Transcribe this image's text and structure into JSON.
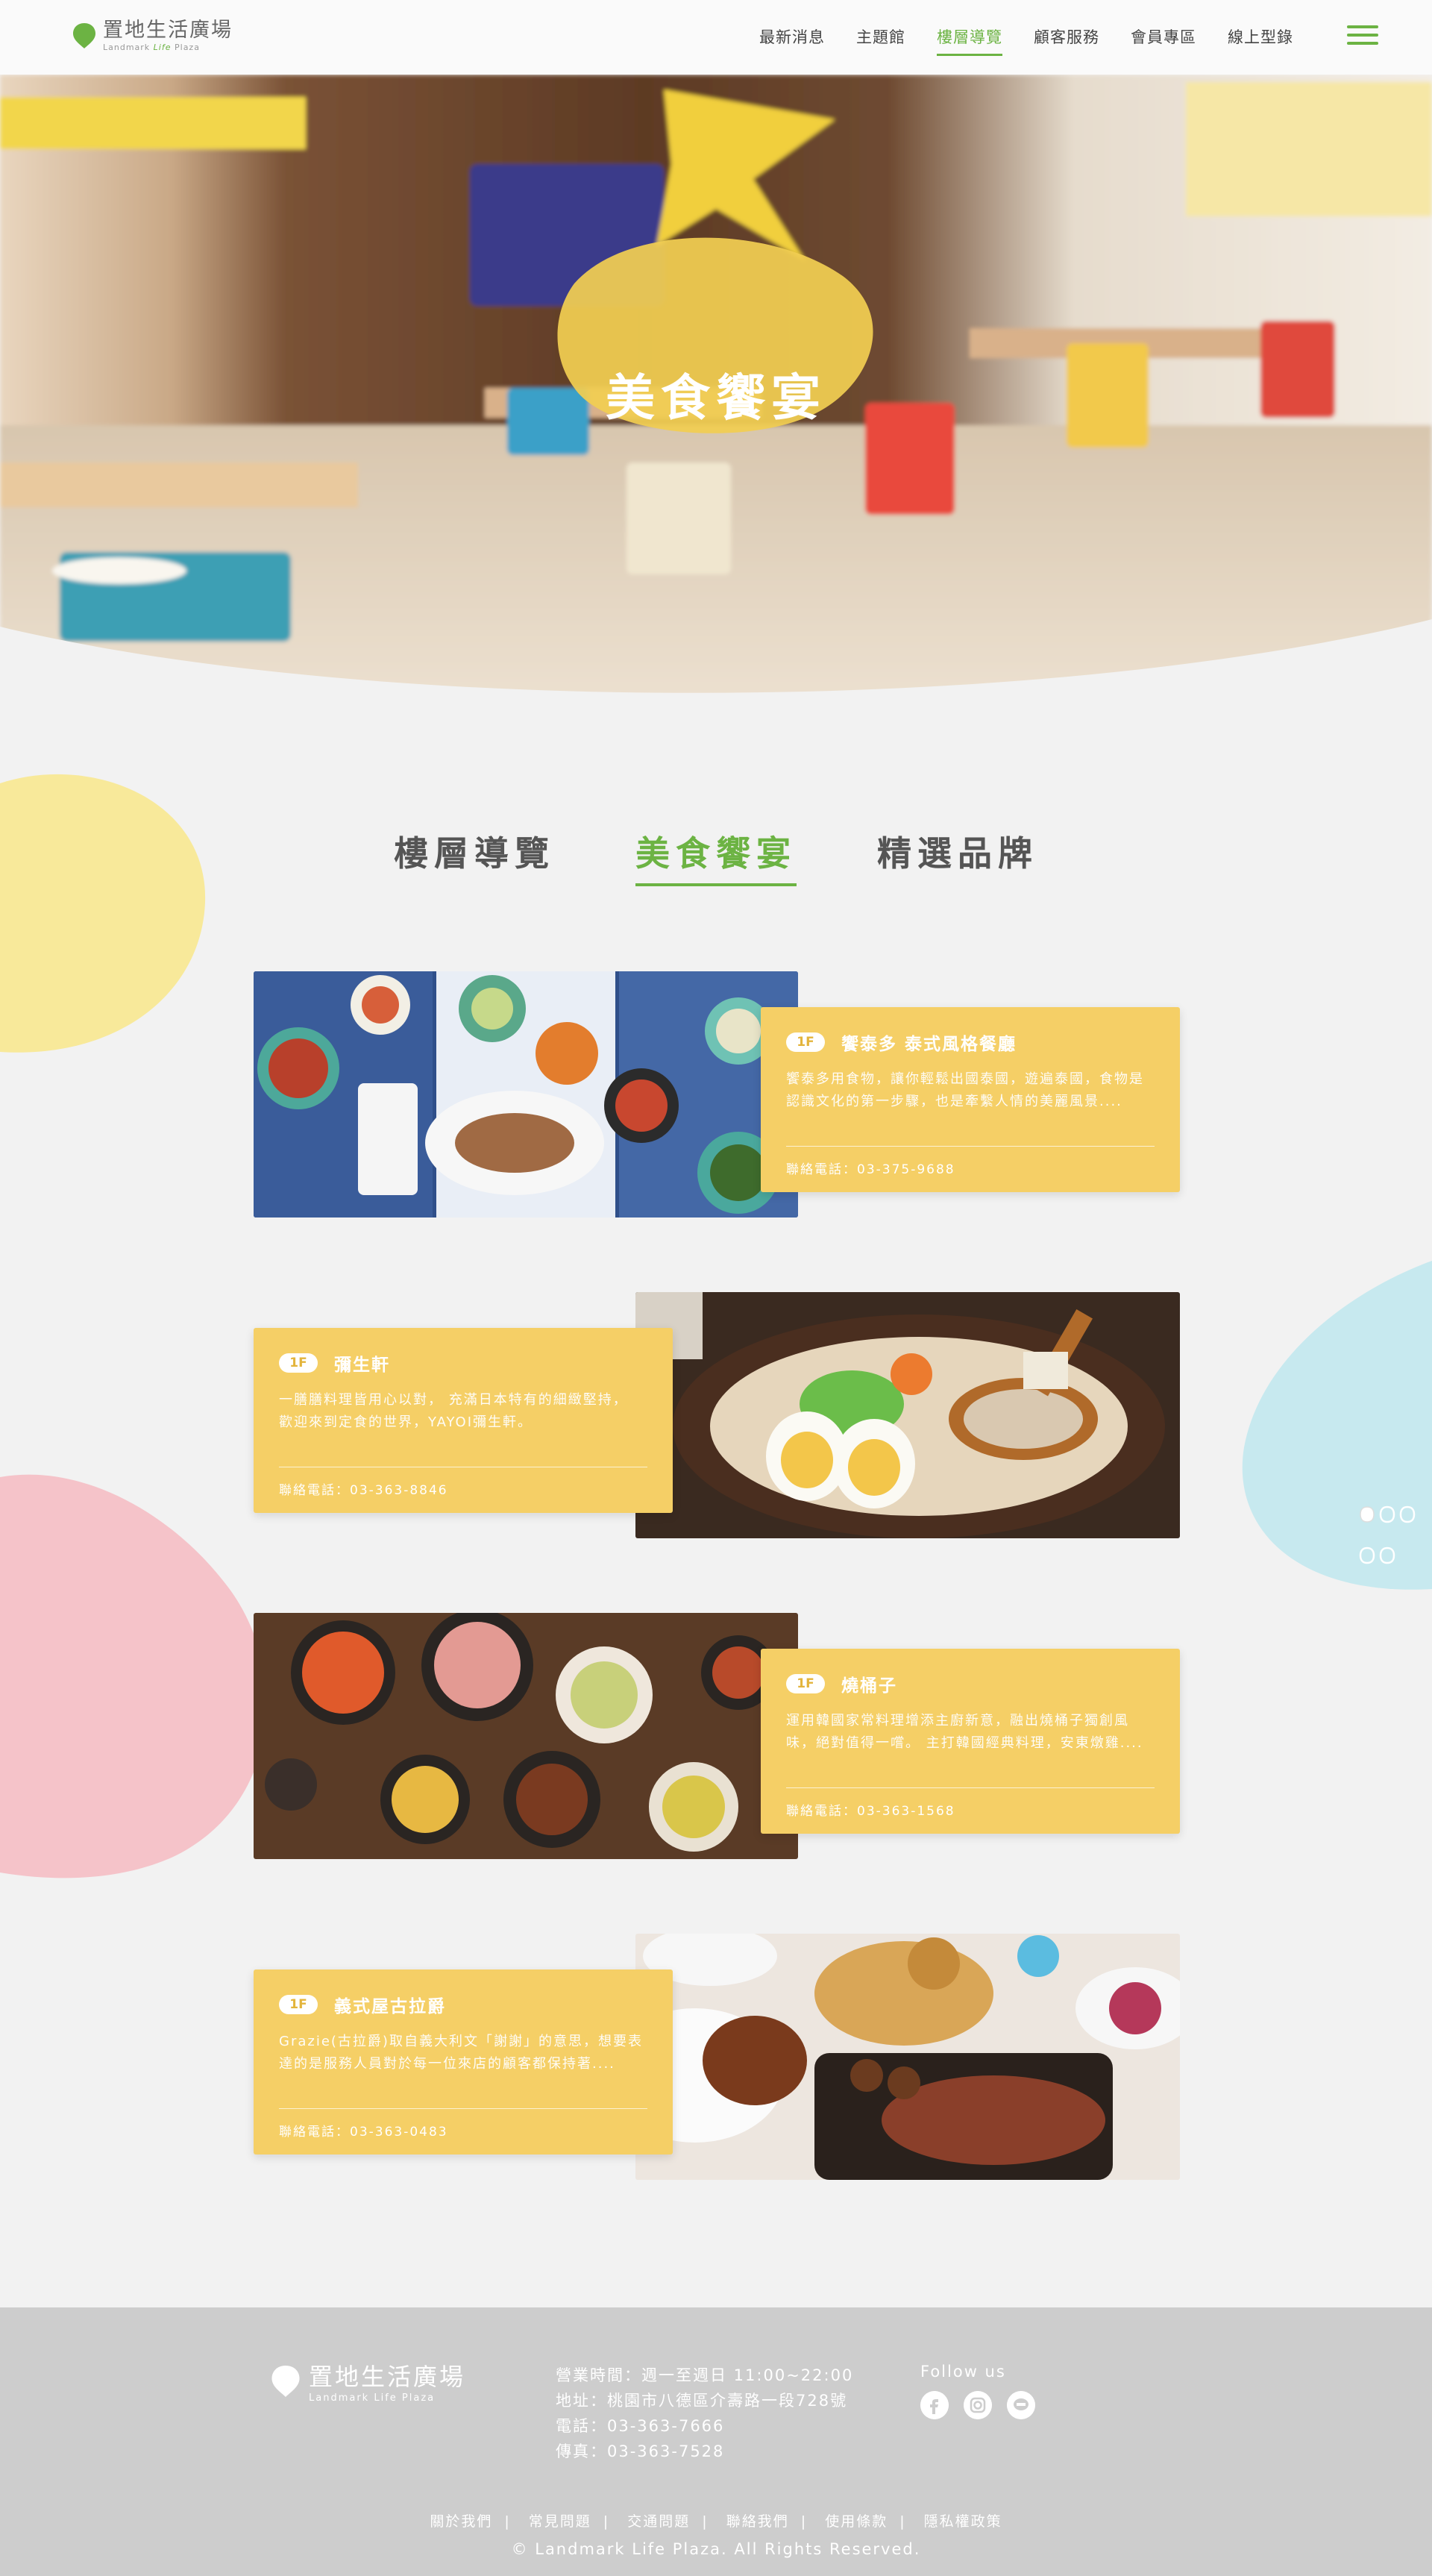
{
  "brand": {
    "name_cn": "置地生活廣場",
    "name_en_left": "Landmark",
    "name_en_life": "Life",
    "name_en_right": "Plaza"
  },
  "nav": [
    {
      "label": "最新消息",
      "active": false
    },
    {
      "label": "主題館",
      "active": false
    },
    {
      "label": "樓層導覽",
      "active": true
    },
    {
      "label": "顧客服務",
      "active": false
    },
    {
      "label": "會員專區",
      "active": false
    },
    {
      "label": "線上型錄",
      "active": false
    }
  ],
  "hero": {
    "title": "美食饗宴"
  },
  "tabs": [
    {
      "label": "樓層導覽",
      "active": false
    },
    {
      "label": "美食饗宴",
      "active": true
    },
    {
      "label": "精選品牌",
      "active": false
    }
  ],
  "restaurants": [
    {
      "floor": "1F",
      "name": "饗泰多 泰式風格餐廳",
      "desc": "饗泰多用食物，讓你輕鬆出國泰國，遊遍泰國，食物是認識文化的第一步驟，也是牽繫人情的美麗風景....",
      "tel": "聯絡電話：03-375-9688"
    },
    {
      "floor": "1F",
      "name": "彌生軒",
      "desc": "一膳膳料理皆用心以對， 充滿日本特有的細緻堅持， 歡迎來到定食的世界，YAYOI彌生軒。",
      "tel": "聯絡電話：03-363-8846"
    },
    {
      "floor": "1F",
      "name": "燒桶子",
      "desc": "運用韓國家常料理增添主廚新意，融出燒桶子獨創風味，絕對值得一嚐。 主打韓國經典料理，安東燉雞....",
      "tel": "聯絡電話：03-363-1568"
    },
    {
      "floor": "1F",
      "name": "義式屋古拉爵",
      "desc": "Grazie(古拉爵)取自義大利文「謝謝」的意思，想要表達的是服務人員對於每一位來店的顧客都保持著....",
      "tel": "聯絡電話：03-363-0483"
    }
  ],
  "footer": {
    "name_cn": "置地生活廣場",
    "name_en": "Landmark Life Plaza",
    "info": [
      "營業時間：週一至週日 11:00~22:00",
      "地址：桃園市八德區介壽路一段728號",
      "電話：03-363-7666",
      "傳真：03-363-7528"
    ],
    "follow_label": "Follow us",
    "links": [
      "關於我們",
      "常見問題",
      "交通問題",
      "聯絡我們",
      "使用條款",
      "隱私權政策"
    ],
    "copyright": "© Landmark Life Plaza. All Rights Reserved."
  },
  "colors": {
    "accent_green": "#6cb343",
    "card_yellow": "#f5cf66",
    "blob_yellow": "#f8e99a",
    "blob_pink": "#f5c3c9",
    "blob_blue": "#c7e9ef",
    "footer_gray": "#cdcdcd"
  }
}
